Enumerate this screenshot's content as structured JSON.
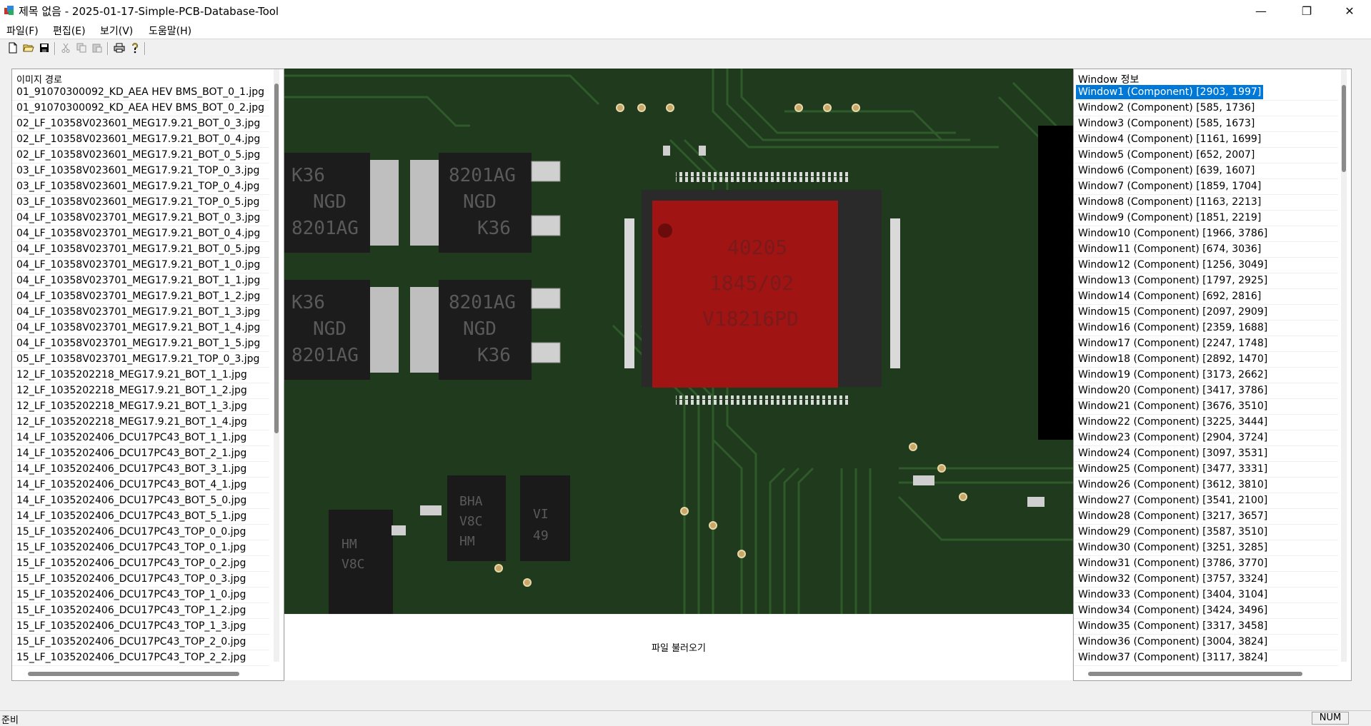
{
  "window": {
    "title": "제목 없음 - 2025-01-17-Simple-PCB-Database-Tool",
    "minimize_glyph": "—",
    "restore_glyph": "❐",
    "close_glyph": "✕"
  },
  "menu": {
    "items": [
      "파일(F)",
      "편집(E)",
      "보기(V)",
      "도움말(H)"
    ]
  },
  "toolbar": {
    "buttons": [
      "new-icon",
      "open-icon",
      "save-icon",
      "cut-icon",
      "copy-icon",
      "paste-icon",
      "print-icon",
      "help-icon"
    ]
  },
  "left_panel": {
    "header": "이미지 경로",
    "files": [
      "01_91070300092_KD_AEA HEV BMS_BOT_0_1.jpg",
      "01_91070300092_KD_AEA HEV BMS_BOT_0_2.jpg",
      "02_LF_10358V023601_MEG17.9.21_BOT_0_3.jpg",
      "02_LF_10358V023601_MEG17.9.21_BOT_0_4.jpg",
      "02_LF_10358V023601_MEG17.9.21_BOT_0_5.jpg",
      "03_LF_10358V023601_MEG17.9.21_TOP_0_3.jpg",
      "03_LF_10358V023601_MEG17.9.21_TOP_0_4.jpg",
      "03_LF_10358V023601_MEG17.9.21_TOP_0_5.jpg",
      "04_LF_10358V023701_MEG17.9.21_BOT_0_3.jpg",
      "04_LF_10358V023701_MEG17.9.21_BOT_0_4.jpg",
      "04_LF_10358V023701_MEG17.9.21_BOT_0_5.jpg",
      "04_LF_10358V023701_MEG17.9.21_BOT_1_0.jpg",
      "04_LF_10358V023701_MEG17.9.21_BOT_1_1.jpg",
      "04_LF_10358V023701_MEG17.9.21_BOT_1_2.jpg",
      "04_LF_10358V023701_MEG17.9.21_BOT_1_3.jpg",
      "04_LF_10358V023701_MEG17.9.21_BOT_1_4.jpg",
      "04_LF_10358V023701_MEG17.9.21_BOT_1_5.jpg",
      "05_LF_10358V023701_MEG17.9.21_TOP_0_3.jpg",
      "12_LF_1035202218_MEG17.9.21_BOT_1_1.jpg",
      "12_LF_1035202218_MEG17.9.21_BOT_1_2.jpg",
      "12_LF_1035202218_MEG17.9.21_BOT_1_3.jpg",
      "12_LF_1035202218_MEG17.9.21_BOT_1_4.jpg",
      "14_LF_1035202406_DCU17PC43_BOT_1_1.jpg",
      "14_LF_1035202406_DCU17PC43_BOT_2_1.jpg",
      "14_LF_1035202406_DCU17PC43_BOT_3_1.jpg",
      "14_LF_1035202406_DCU17PC43_BOT_4_1.jpg",
      "14_LF_1035202406_DCU17PC43_BOT_5_0.jpg",
      "14_LF_1035202406_DCU17PC43_BOT_5_1.jpg",
      "15_LF_1035202406_DCU17PC43_TOP_0_0.jpg",
      "15_LF_1035202406_DCU17PC43_TOP_0_1.jpg",
      "15_LF_1035202406_DCU17PC43_TOP_0_2.jpg",
      "15_LF_1035202406_DCU17PC43_TOP_0_3.jpg",
      "15_LF_1035202406_DCU17PC43_TOP_1_0.jpg",
      "15_LF_1035202406_DCU17PC43_TOP_1_2.jpg",
      "15_LF_1035202406_DCU17PC43_TOP_1_3.jpg",
      "15_LF_1035202406_DCU17PC43_TOP_2_0.jpg",
      "15_LF_1035202406_DCU17PC43_TOP_2_2.jpg"
    ]
  },
  "center": {
    "load_button_label": "파일 불러오기",
    "chip_markings": {
      "diode_top_left": [
        "K36",
        "NGD",
        "8201AG"
      ],
      "diode_top_right": [
        "8201AG",
        "NGD",
        "K36"
      ],
      "diode_bottom_left": [
        "K36",
        "NGD",
        "8201AG"
      ],
      "diode_bottom_right": [
        "8201AG",
        "NGD",
        "K36"
      ],
      "ic_main": [
        "40205",
        "1845/02",
        "V18216PD"
      ],
      "small_left": [
        "HM",
        "V8C"
      ],
      "small_middle": [
        "BHA",
        "V8C",
        "HM"
      ],
      "small_right": [
        "VI",
        "49"
      ]
    }
  },
  "right_panel": {
    "header": "Window 정보",
    "selected_index": 0,
    "windows": [
      "Window1 (Component) [2903, 1997]",
      "Window2 (Component) [585, 1736]",
      "Window3 (Component) [585, 1673]",
      "Window4 (Component) [1161, 1699]",
      "Window5 (Component) [652, 2007]",
      "Window6 (Component) [639, 1607]",
      "Window7 (Component) [1859, 1704]",
      "Window8 (Component) [1163, 2213]",
      "Window9 (Component) [1851, 2219]",
      "Window10 (Component) [1966, 3786]",
      "Window11 (Component) [674, 3036]",
      "Window12 (Component) [1256, 3049]",
      "Window13 (Component) [1797, 2925]",
      "Window14 (Component) [692, 2816]",
      "Window15 (Component) [2097, 2909]",
      "Window16 (Component) [2359, 1688]",
      "Window17 (Component) [2247, 1748]",
      "Window18 (Component) [2892, 1470]",
      "Window19 (Component) [3173, 2662]",
      "Window20 (Component) [3417, 3786]",
      "Window21 (Component) [3676, 3510]",
      "Window22 (Component) [3225, 3444]",
      "Window23 (Component) [2904, 3724]",
      "Window24 (Component) [3097, 3531]",
      "Window25 (Component) [3477, 3331]",
      "Window26 (Component) [3612, 3810]",
      "Window27 (Component) [3541, 2100]",
      "Window28 (Component) [3217, 3657]",
      "Window29 (Component) [3587, 3510]",
      "Window30 (Component) [3251, 3285]",
      "Window31 (Component) [3786, 3770]",
      "Window32 (Component) [3757, 3324]",
      "Window33 (Component) [3404, 3104]",
      "Window34 (Component) [3424, 3496]",
      "Window35 (Component) [3317, 3458]",
      "Window36 (Component) [3004, 3824]",
      "Window37 (Component) [3117, 3824]"
    ]
  },
  "status": {
    "text": "준비",
    "num": "NUM"
  },
  "colors": {
    "pcb_green": "#1f3a1d",
    "selection": "#0078d7",
    "highlight_red": "#c81414"
  }
}
